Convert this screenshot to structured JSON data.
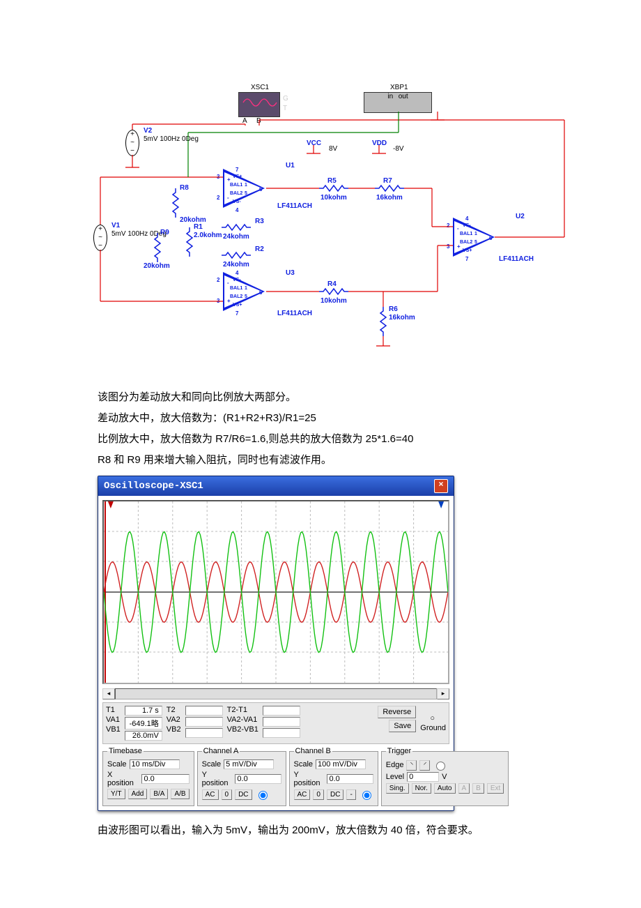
{
  "circuit": {
    "instruments": {
      "scope": {
        "label": "XSC1",
        "portA": "A",
        "portB": "B",
        "G": "G",
        "T": "T"
      },
      "bode": {
        "label": "XBP1",
        "in": "in",
        "out": "out"
      }
    },
    "sources": {
      "v2": {
        "name": "V2",
        "spec": "5mV 100Hz 0Deg"
      },
      "v1": {
        "name": "V1",
        "spec": "5mV 100Hz 0Deg"
      }
    },
    "rails": {
      "vcc": "VCC",
      "vcc_v": "8V",
      "vdd": "VDD",
      "vdd_v": "-8V"
    },
    "amps": {
      "u1": {
        "name": "U1",
        "part": "LF411ACH"
      },
      "u2": {
        "name": "U2",
        "part": "LF411ACH"
      },
      "u3": {
        "name": "U3",
        "part": "LF411ACH"
      }
    },
    "resistors": {
      "r1": {
        "name": "R1",
        "val": "2.0kohm"
      },
      "r2": {
        "name": "R2",
        "val": "24kohm"
      },
      "r3": {
        "name": "R3",
        "val": "24kohm"
      },
      "r4": {
        "name": "R4",
        "val": "10kohm"
      },
      "r5": {
        "name": "R5",
        "val": "10kohm"
      },
      "r6": {
        "name": "R6",
        "val": "16kohm"
      },
      "r7": {
        "name": "R7",
        "val": "16kohm"
      },
      "r8": {
        "name": "R8",
        "val": "20kohm"
      },
      "r9": {
        "name": "R9",
        "val": "20kohm"
      }
    },
    "pins": {
      "p1": "1",
      "p2": "2",
      "p3": "3",
      "p4": "4",
      "p5": "5",
      "p6": "6",
      "p7": "7",
      "bal1": "BAL1",
      "bal2": "BAL2",
      "vp": "VS+",
      "vn": "VS-",
      "plus": "+",
      "minus": "-"
    }
  },
  "text": {
    "line1": "该图分为差动放大和同向比例放大两部分。",
    "line2": "差动放大中，放大倍数为：(R1+R2+R3)/R1=25",
    "line3": "比例放大中，放大倍数为 R7/R6=1.6,则总共的放大倍数为 25*1.6=40",
    "line4": "R8 和 R9 用来增大输入阻抗，同时也有滤波作用。",
    "line5": "由波形图可以看出，输入为 5mV，输出为 200mV，放大倍数为 40 倍，符合要求。"
  },
  "scope": {
    "title": "Oscilloscope-XSC1",
    "readout": {
      "labels": {
        "t1": "T1",
        "va1": "VA1",
        "vb1": "VB1",
        "t2": "T2",
        "va2": "VA2",
        "vb2": "VB2",
        "dt": "T2-T1",
        "dva": "VA2-VA1",
        "dvb": "VB2-VB1"
      },
      "t1": "1.7 s",
      "va1": "-649.1略",
      "vb1": "26.0mV",
      "reverse": "Reverse",
      "save": "Save",
      "ground": "Ground"
    },
    "panel": {
      "timebase": {
        "legend": "Timebase",
        "scale_lbl": "Scale",
        "scale": "10 ms/Div",
        "xpos_lbl": "X position",
        "xpos": "0.0",
        "yt": "Y/T",
        "add": "Add",
        "ba": "B/A",
        "ab": "A/B"
      },
      "chA": {
        "legend": "Channel A",
        "scale_lbl": "Scale",
        "scale": "5 mV/Div",
        "ypos_lbl": "Y position",
        "ypos": "0.0",
        "ac": "AC",
        "zero": "0",
        "dc": "DC"
      },
      "chB": {
        "legend": "Channel B",
        "scale_lbl": "Scale",
        "scale": "100 mV/Div",
        "ypos_lbl": "Y position",
        "ypos": "0.0",
        "ac": "AC",
        "zero": "0",
        "dc": "DC",
        "minus": "-"
      },
      "trig": {
        "legend": "Trigger",
        "edge": "Edge",
        "level_lbl": "Level",
        "level": "0",
        "v": "V",
        "sing": "Sing.",
        "nor": "Nor.",
        "auto": "Auto",
        "a": "A",
        "b": "B",
        "ext": "Ext"
      }
    },
    "chart_data": {
      "type": "line",
      "x_unit": "ms",
      "timebase_ms_per_div": 10,
      "divisions_x": 10,
      "series": [
        {
          "name": "Channel A",
          "color": "#d02020",
          "scale": "5 mV/Div",
          "peak_mV": 5,
          "freq_Hz": 100,
          "phase_deg": 0
        },
        {
          "name": "Channel B",
          "color": "#10c010",
          "scale": "100 mV/Div",
          "peak_mV": 200,
          "freq_Hz": 100,
          "phase_deg": 180
        }
      ],
      "cycles_visible": 10
    }
  }
}
